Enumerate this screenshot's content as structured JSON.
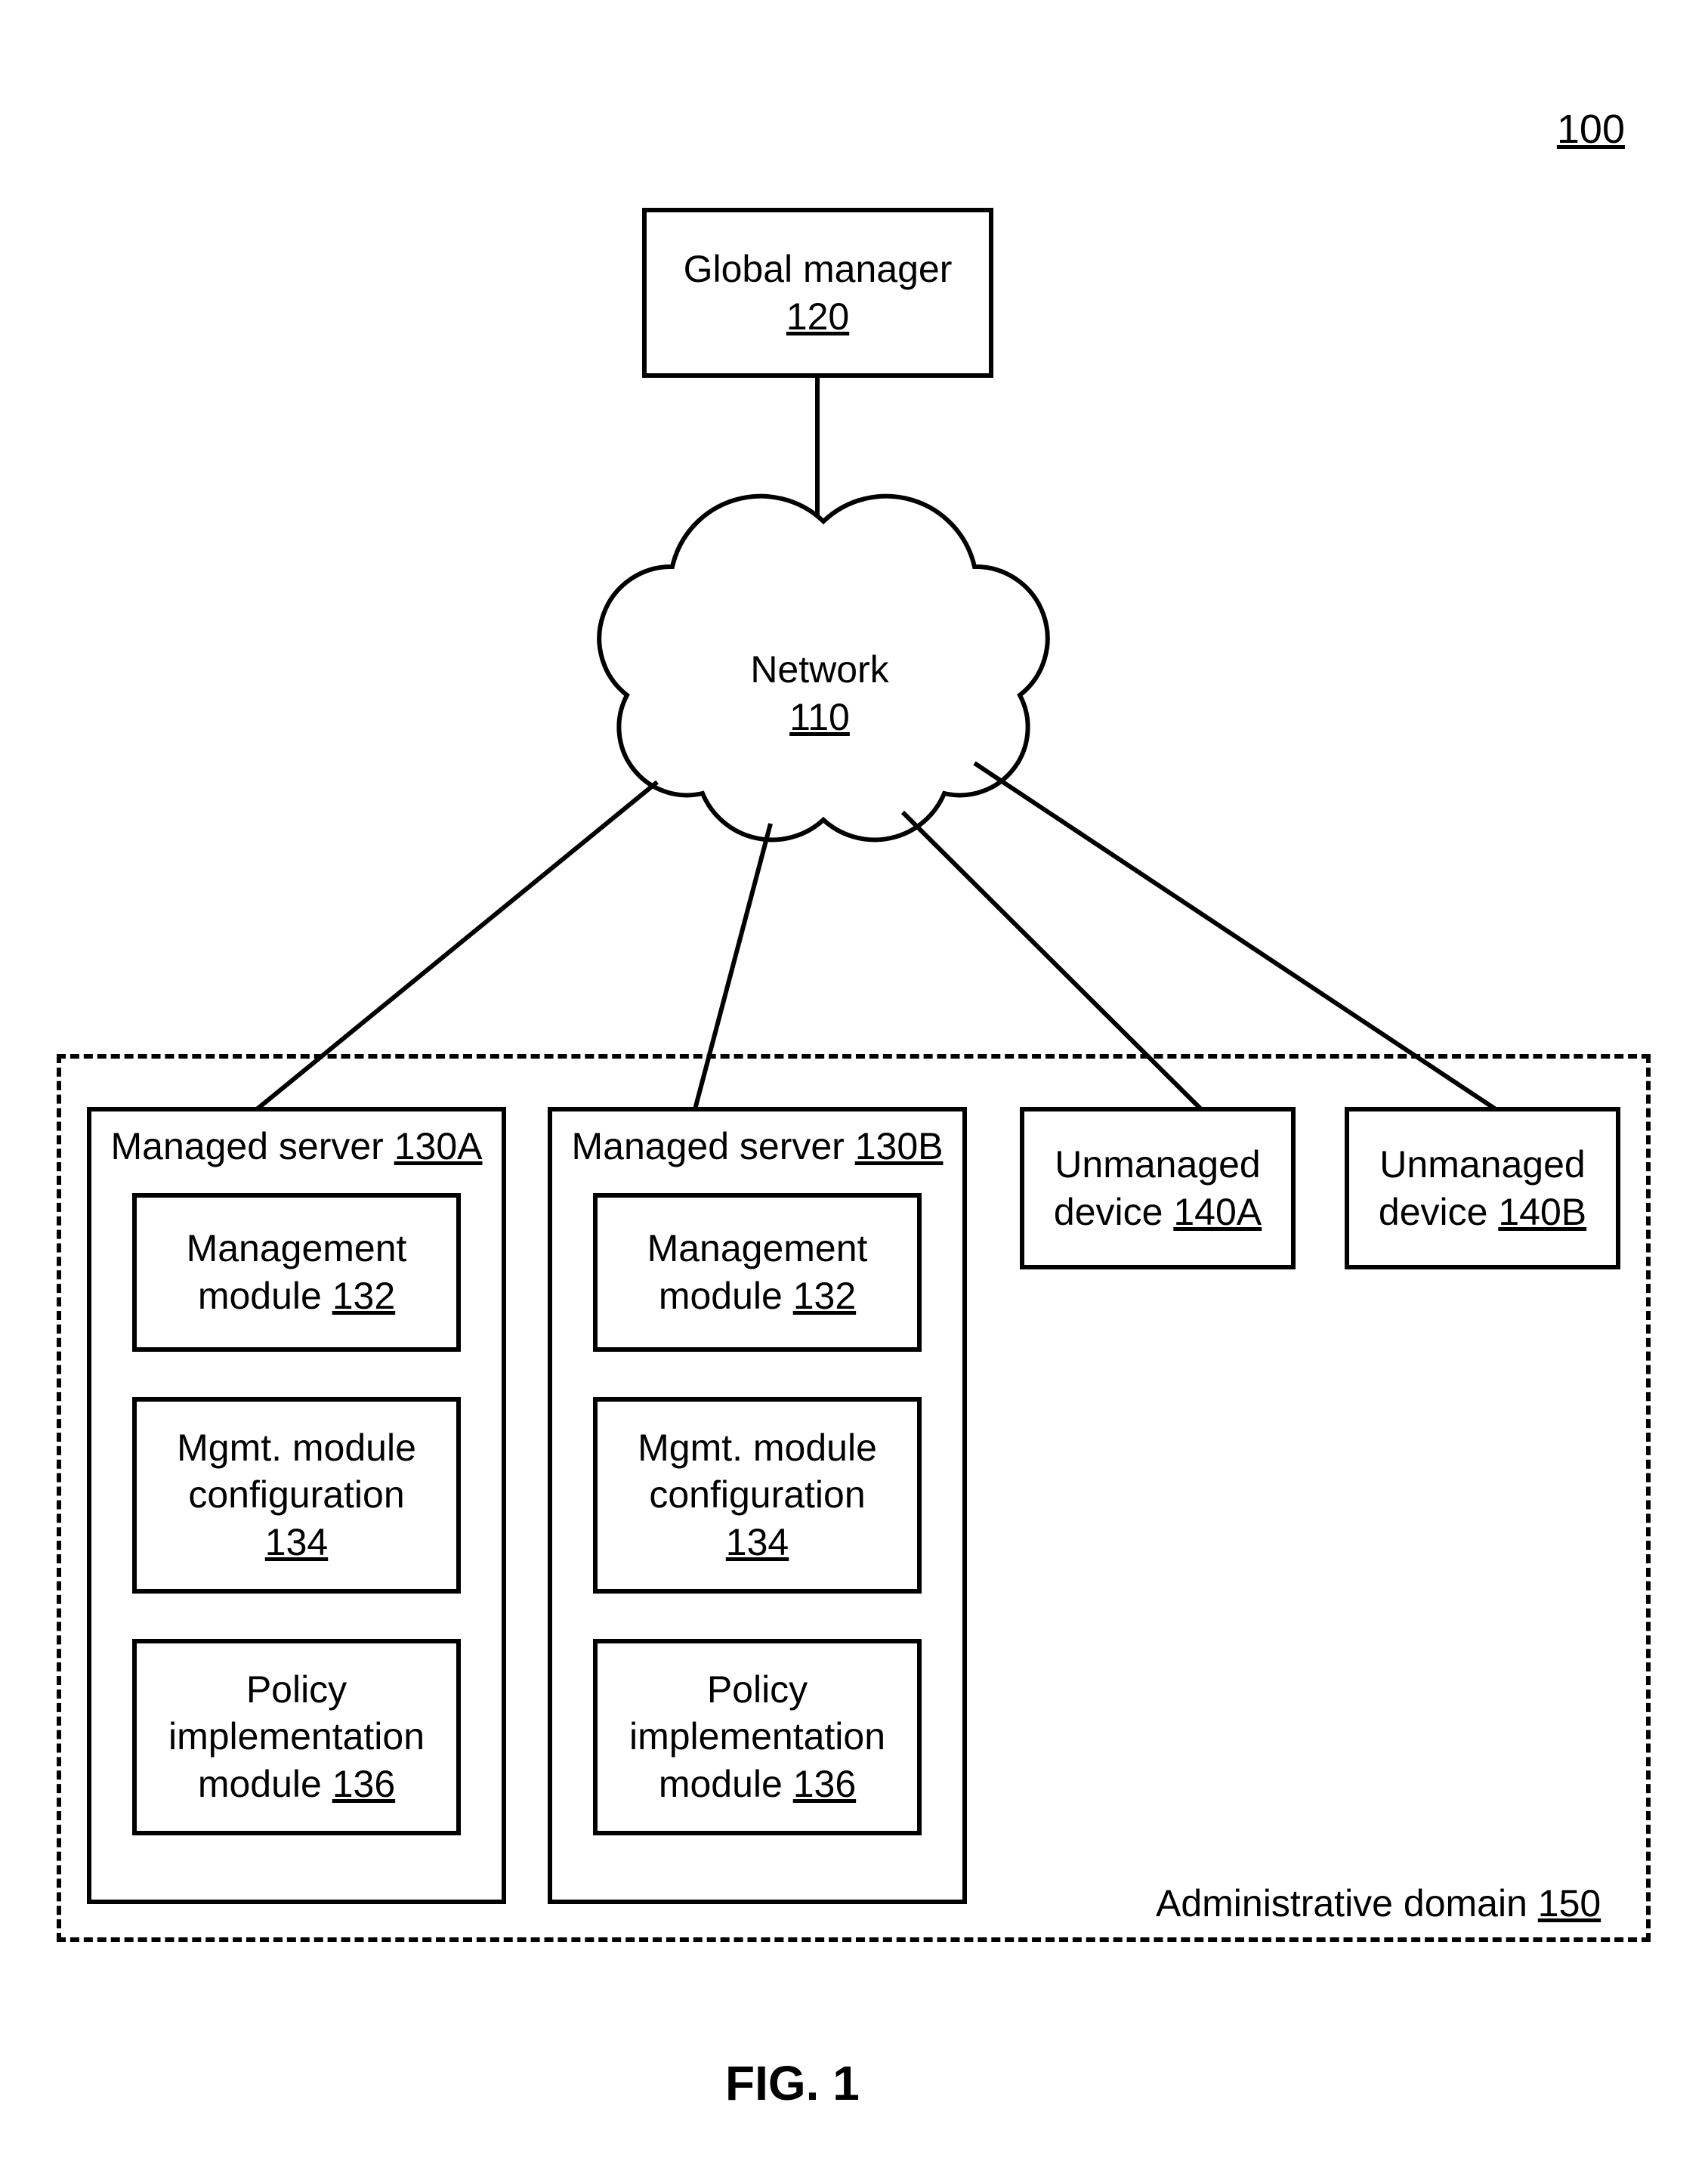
{
  "figure_ref": "100",
  "caption": "FIG. 1",
  "global_manager": {
    "title": "Global manager",
    "ref": "120"
  },
  "network": {
    "title": "Network",
    "ref": "110"
  },
  "domain": {
    "title": "Administrative domain ",
    "ref": "150"
  },
  "servers": [
    {
      "title": "Managed server ",
      "ref": "130A",
      "modules": {
        "mgmt": {
          "l1": "Management",
          "l2": "module ",
          "ref": "132"
        },
        "config": {
          "l1": "Mgmt. module",
          "l2": "configuration",
          "ref": "134"
        },
        "policy": {
          "l1": "Policy",
          "l2": "implementation",
          "l3": "module ",
          "ref": "136"
        }
      }
    },
    {
      "title": "Managed server ",
      "ref": "130B",
      "modules": {
        "mgmt": {
          "l1": "Management",
          "l2": "module ",
          "ref": "132"
        },
        "config": {
          "l1": "Mgmt. module",
          "l2": "configuration",
          "ref": "134"
        },
        "policy": {
          "l1": "Policy",
          "l2": "implementation",
          "l3": "module ",
          "ref": "136"
        }
      }
    }
  ],
  "devices": [
    {
      "l1": "Unmanaged",
      "l2": "device ",
      "ref": "140A"
    },
    {
      "l1": "Unmanaged",
      "l2": "device ",
      "ref": "140B"
    }
  ]
}
